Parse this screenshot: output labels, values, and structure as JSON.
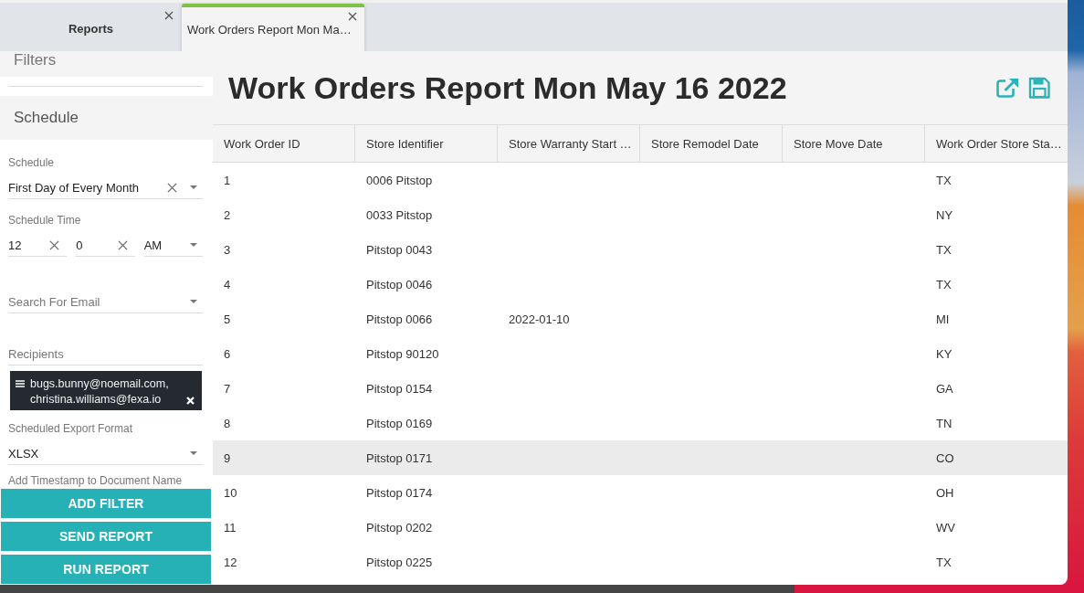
{
  "tabs": [
    {
      "label": "Reports",
      "selected": false
    },
    {
      "label": "Work Orders Report Mon Ma…",
      "selected": true
    }
  ],
  "sidebar": {
    "sections": [
      {
        "title": "Filters"
      },
      {
        "title": "Schedule"
      }
    ],
    "fields": [
      {
        "kind": "select",
        "label": "Schedule",
        "value": "First Day of Every Month",
        "clearable": true
      },
      {
        "kind": "time",
        "label": "Schedule Time",
        "parts": [
          {
            "kind": "input",
            "value": "12"
          },
          {
            "kind": "input",
            "value": "0"
          },
          {
            "kind": "select",
            "value": "AM"
          }
        ]
      },
      {
        "kind": "search",
        "placeholder": "Search For Email"
      },
      {
        "kind": "chips",
        "placeholder": "Recipients",
        "chips": [
          {
            "text": "bugs.bunny@noemail.com, christina.williams@fexa.io"
          }
        ]
      },
      {
        "kind": "select",
        "label": "Scheduled Export Format",
        "value": "XLSX",
        "clearable": false
      },
      {
        "kind": "heading",
        "label": "Add Timestamp to Document Name"
      }
    ],
    "buttons": [
      "ADD FILTER",
      "SEND REPORT",
      "RUN REPORT"
    ]
  },
  "main": {
    "title": "Work Orders Report Mon May 16 2022",
    "table": {
      "columns": [
        "Work Order ID",
        "Store Identifier",
        "Store Warranty Start …",
        "Store Remodel Date",
        "Store Move Date",
        "Work Order Store Sta…"
      ],
      "rows": [
        {
          "work_order_id": "1",
          "store_identifier": "0006 Pitstop",
          "column_6": "TX",
          "selected": false
        },
        {
          "work_order_id": "2",
          "store_identifier": "0033 Pitstop",
          "column_6": "NY",
          "selected": false
        },
        {
          "work_order_id": "3",
          "store_identifier": "Pitstop 0043",
          "column_6": "TX",
          "selected": false
        },
        {
          "work_order_id": "4",
          "store_identifier": "Pitstop 0046",
          "column_6": "TX",
          "selected": false
        },
        {
          "work_order_id": "5",
          "store_identifier": "Pitstop 0066",
          "column_3": "2022-01-10",
          "column_6": "MI",
          "selected": false
        },
        {
          "work_order_id": "6",
          "store_identifier": "Pitstop 90120",
          "column_6": "KY",
          "selected": false
        },
        {
          "work_order_id": "7",
          "store_identifier": "Pitstop 0154",
          "column_6": "GA",
          "selected": false
        },
        {
          "work_order_id": "8",
          "store_identifier": "Pitstop 0169",
          "column_6": "TN",
          "selected": false
        },
        {
          "work_order_id": "9",
          "store_identifier": "Pitstop 0171",
          "column_6": "CO",
          "selected": true
        },
        {
          "work_order_id": "10",
          "store_identifier": "Pitstop 0174",
          "column_6": "OH",
          "selected": false
        },
        {
          "work_order_id": "11",
          "store_identifier": "Pitstop 0202",
          "column_6": "WV",
          "selected": false
        },
        {
          "work_order_id": "12",
          "store_identifier": "Pitstop 0225",
          "column_6": "TX",
          "selected": false
        }
      ]
    }
  }
}
